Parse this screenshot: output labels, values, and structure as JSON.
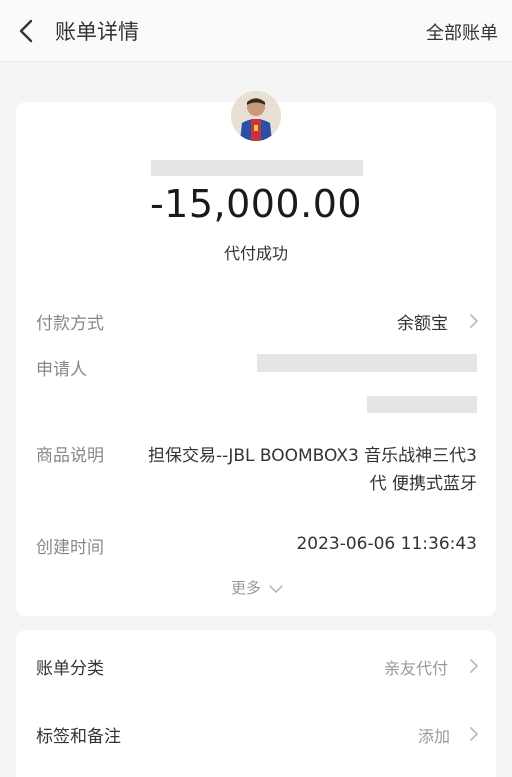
{
  "header": {
    "title": "账单详情",
    "all_bills": "全部账单"
  },
  "summary": {
    "amount": "-15,000.00",
    "status": "代付成功"
  },
  "details": {
    "payment_method_label": "付款方式",
    "payment_method_value": "余额宝",
    "applicant_label": "申请人",
    "product_label": "商品说明",
    "product_value_line1": "担保交易--JBL BOOMBOX3 音乐战神三代3",
    "product_value_line2": "代 便携式蓝牙",
    "created_label": "创建时间",
    "created_value": "2023-06-06 11:36:43",
    "more_label": "更多"
  },
  "extra": {
    "category_label": "账单分类",
    "category_value": "亲友代付",
    "tags_label": "标签和备注",
    "tags_value": "添加"
  },
  "icons": [
    "back-arrow-icon",
    "chevron-right-icon",
    "chevron-down-icon",
    "avatar"
  ]
}
